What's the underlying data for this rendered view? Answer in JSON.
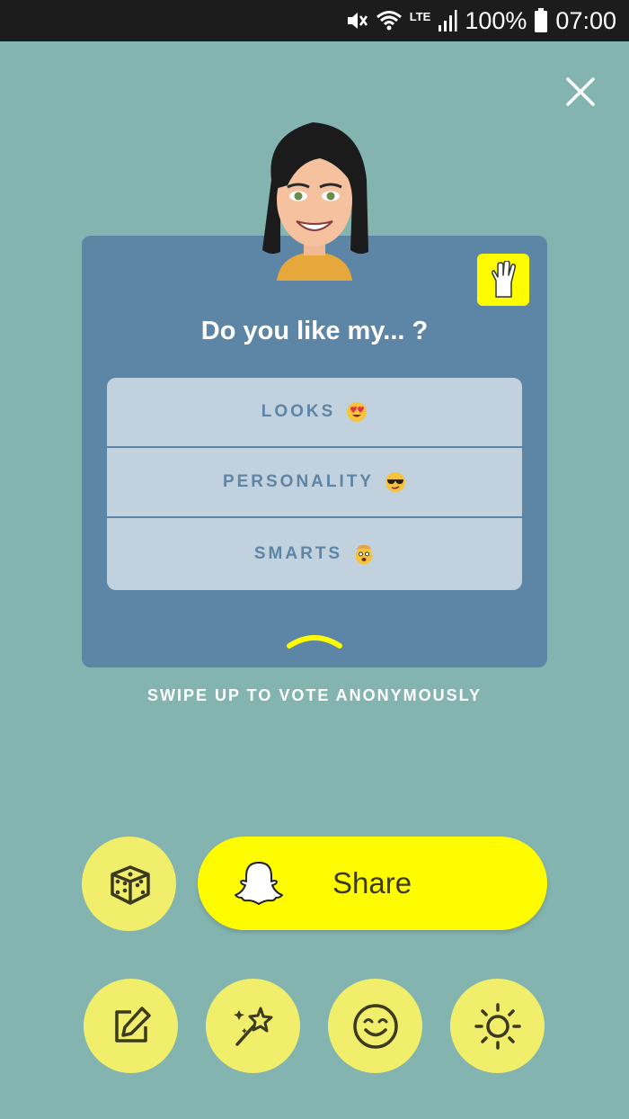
{
  "status_bar": {
    "network": "LTE",
    "battery": "100%",
    "time": "07:00",
    "icons": [
      "mute-icon",
      "wifi-icon",
      "lte-icon",
      "signal-icon",
      "battery-icon"
    ]
  },
  "card": {
    "question": "Do you like my... ?",
    "options": [
      {
        "label": "LOOKS",
        "emoji": "heart-eyes-emoji"
      },
      {
        "label": "PERSONALITY",
        "emoji": "sunglasses-emoji"
      },
      {
        "label": "SMARTS",
        "emoji": "exploding-head-emoji"
      }
    ]
  },
  "swipe_hint": "SWIPE UP TO VOTE ANONYMOUSLY",
  "share_button": {
    "label": "Share",
    "icon": "snapchat-ghost-icon"
  },
  "tools": [
    "dice-icon",
    "edit-icon",
    "magic-wand-icon",
    "smiley-icon",
    "brightness-icon"
  ],
  "colors": {
    "background": "#84b4b0",
    "card": "#5d85a6",
    "options_bg": "#c2d1de",
    "accent_yellow": "#fffc00",
    "tool_yellow": "#f0ee6a"
  }
}
